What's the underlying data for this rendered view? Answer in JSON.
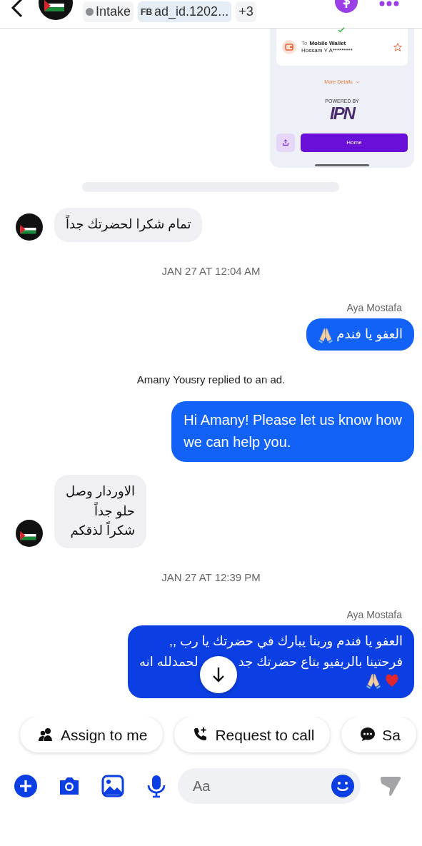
{
  "header": {
    "status_tag": "Intake",
    "source_tag": {
      "prefix": "FB",
      "label": "ad_id.1202..."
    },
    "more_tags": "+3"
  },
  "messages": [
    {
      "kind": "receipt",
      "recipient_label": "To",
      "wallet": "Mobile Wallet",
      "recipient": "Hossam Y A*********",
      "more": "More Details",
      "powered": "POWERED BY",
      "logo": "IPN",
      "button": "Home"
    },
    {
      "kind": "bar"
    },
    {
      "kind": "incoming",
      "text": "تمام شكرا لحضرتك جداً"
    },
    {
      "kind": "timestamp",
      "text": "JAN 27 AT 12:04 AM"
    },
    {
      "kind": "sender",
      "text": "Aya Mostafa"
    },
    {
      "kind": "outgoing",
      "rtl": true,
      "lines": [
        {
          "text": "العفو يا فندم"
        }
      ],
      "icons": [
        {
          "kind": "pray"
        }
      ]
    },
    {
      "kind": "system",
      "text": "Amany Yousry replied to an ad."
    },
    {
      "kind": "outgoing",
      "rtl": false,
      "lines": [
        {
          "text": "Hi Amany! Please let us know how"
        },
        {
          "text": "we can help you."
        }
      ]
    },
    {
      "kind": "incoming",
      "text": "الاوردار وصل\nحلو جداً\nشكراً لذقكم"
    },
    {
      "kind": "timestamp",
      "text": "JAN 27 AT 12:39 PM"
    },
    {
      "kind": "sender",
      "text": "Aya Mostafa"
    },
    {
      "kind": "outgoing",
      "rtl": true,
      "lines": [
        {
          "text": "العفو يا فندم وربنا يبارك في حضرتك يا رب ,,"
        },
        {
          "text": "فرحتينا بالريفيو بتاع حضرتك جد",
          "after_gap": "لحمدلله انه"
        }
      ],
      "icons": [
        {
          "kind": "heart"
        },
        {
          "kind": "pray"
        }
      ],
      "scroll_button": true
    }
  ],
  "actions": {
    "assign": "Assign to me",
    "request_call": "Request to call",
    "action_3": "Sa"
  },
  "composer": {
    "placeholder": "Aa"
  }
}
